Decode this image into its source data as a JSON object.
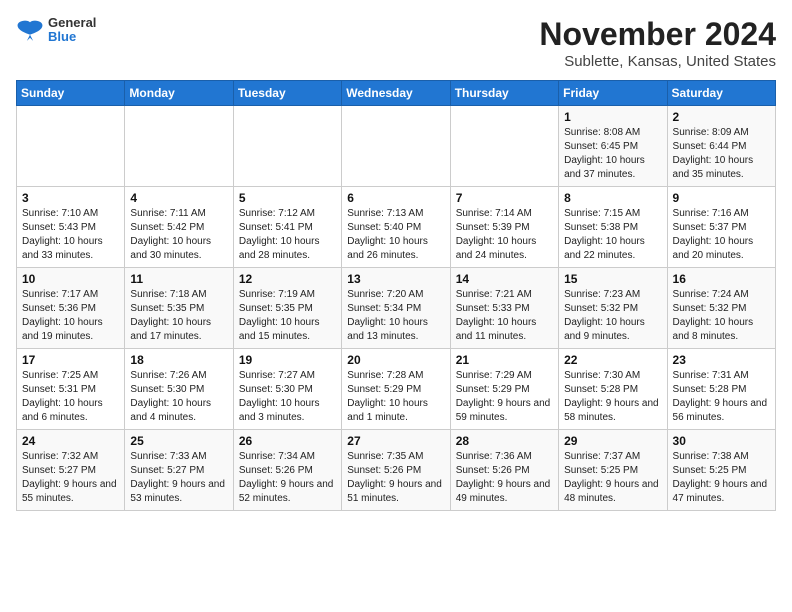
{
  "logo": {
    "general": "General",
    "blue": "Blue"
  },
  "header": {
    "month": "November 2024",
    "location": "Sublette, Kansas, United States"
  },
  "weekdays": [
    "Sunday",
    "Monday",
    "Tuesday",
    "Wednesday",
    "Thursday",
    "Friday",
    "Saturday"
  ],
  "weeks": [
    [
      {
        "day": "",
        "info": ""
      },
      {
        "day": "",
        "info": ""
      },
      {
        "day": "",
        "info": ""
      },
      {
        "day": "",
        "info": ""
      },
      {
        "day": "",
        "info": ""
      },
      {
        "day": "1",
        "info": "Sunrise: 8:08 AM\nSunset: 6:45 PM\nDaylight: 10 hours and 37 minutes."
      },
      {
        "day": "2",
        "info": "Sunrise: 8:09 AM\nSunset: 6:44 PM\nDaylight: 10 hours and 35 minutes."
      }
    ],
    [
      {
        "day": "3",
        "info": "Sunrise: 7:10 AM\nSunset: 5:43 PM\nDaylight: 10 hours and 33 minutes."
      },
      {
        "day": "4",
        "info": "Sunrise: 7:11 AM\nSunset: 5:42 PM\nDaylight: 10 hours and 30 minutes."
      },
      {
        "day": "5",
        "info": "Sunrise: 7:12 AM\nSunset: 5:41 PM\nDaylight: 10 hours and 28 minutes."
      },
      {
        "day": "6",
        "info": "Sunrise: 7:13 AM\nSunset: 5:40 PM\nDaylight: 10 hours and 26 minutes."
      },
      {
        "day": "7",
        "info": "Sunrise: 7:14 AM\nSunset: 5:39 PM\nDaylight: 10 hours and 24 minutes."
      },
      {
        "day": "8",
        "info": "Sunrise: 7:15 AM\nSunset: 5:38 PM\nDaylight: 10 hours and 22 minutes."
      },
      {
        "day": "9",
        "info": "Sunrise: 7:16 AM\nSunset: 5:37 PM\nDaylight: 10 hours and 20 minutes."
      }
    ],
    [
      {
        "day": "10",
        "info": "Sunrise: 7:17 AM\nSunset: 5:36 PM\nDaylight: 10 hours and 19 minutes."
      },
      {
        "day": "11",
        "info": "Sunrise: 7:18 AM\nSunset: 5:35 PM\nDaylight: 10 hours and 17 minutes."
      },
      {
        "day": "12",
        "info": "Sunrise: 7:19 AM\nSunset: 5:35 PM\nDaylight: 10 hours and 15 minutes."
      },
      {
        "day": "13",
        "info": "Sunrise: 7:20 AM\nSunset: 5:34 PM\nDaylight: 10 hours and 13 minutes."
      },
      {
        "day": "14",
        "info": "Sunrise: 7:21 AM\nSunset: 5:33 PM\nDaylight: 10 hours and 11 minutes."
      },
      {
        "day": "15",
        "info": "Sunrise: 7:23 AM\nSunset: 5:32 PM\nDaylight: 10 hours and 9 minutes."
      },
      {
        "day": "16",
        "info": "Sunrise: 7:24 AM\nSunset: 5:32 PM\nDaylight: 10 hours and 8 minutes."
      }
    ],
    [
      {
        "day": "17",
        "info": "Sunrise: 7:25 AM\nSunset: 5:31 PM\nDaylight: 10 hours and 6 minutes."
      },
      {
        "day": "18",
        "info": "Sunrise: 7:26 AM\nSunset: 5:30 PM\nDaylight: 10 hours and 4 minutes."
      },
      {
        "day": "19",
        "info": "Sunrise: 7:27 AM\nSunset: 5:30 PM\nDaylight: 10 hours and 3 minutes."
      },
      {
        "day": "20",
        "info": "Sunrise: 7:28 AM\nSunset: 5:29 PM\nDaylight: 10 hours and 1 minute."
      },
      {
        "day": "21",
        "info": "Sunrise: 7:29 AM\nSunset: 5:29 PM\nDaylight: 9 hours and 59 minutes."
      },
      {
        "day": "22",
        "info": "Sunrise: 7:30 AM\nSunset: 5:28 PM\nDaylight: 9 hours and 58 minutes."
      },
      {
        "day": "23",
        "info": "Sunrise: 7:31 AM\nSunset: 5:28 PM\nDaylight: 9 hours and 56 minutes."
      }
    ],
    [
      {
        "day": "24",
        "info": "Sunrise: 7:32 AM\nSunset: 5:27 PM\nDaylight: 9 hours and 55 minutes."
      },
      {
        "day": "25",
        "info": "Sunrise: 7:33 AM\nSunset: 5:27 PM\nDaylight: 9 hours and 53 minutes."
      },
      {
        "day": "26",
        "info": "Sunrise: 7:34 AM\nSunset: 5:26 PM\nDaylight: 9 hours and 52 minutes."
      },
      {
        "day": "27",
        "info": "Sunrise: 7:35 AM\nSunset: 5:26 PM\nDaylight: 9 hours and 51 minutes."
      },
      {
        "day": "28",
        "info": "Sunrise: 7:36 AM\nSunset: 5:26 PM\nDaylight: 9 hours and 49 minutes."
      },
      {
        "day": "29",
        "info": "Sunrise: 7:37 AM\nSunset: 5:25 PM\nDaylight: 9 hours and 48 minutes."
      },
      {
        "day": "30",
        "info": "Sunrise: 7:38 AM\nSunset: 5:25 PM\nDaylight: 9 hours and 47 minutes."
      }
    ]
  ]
}
